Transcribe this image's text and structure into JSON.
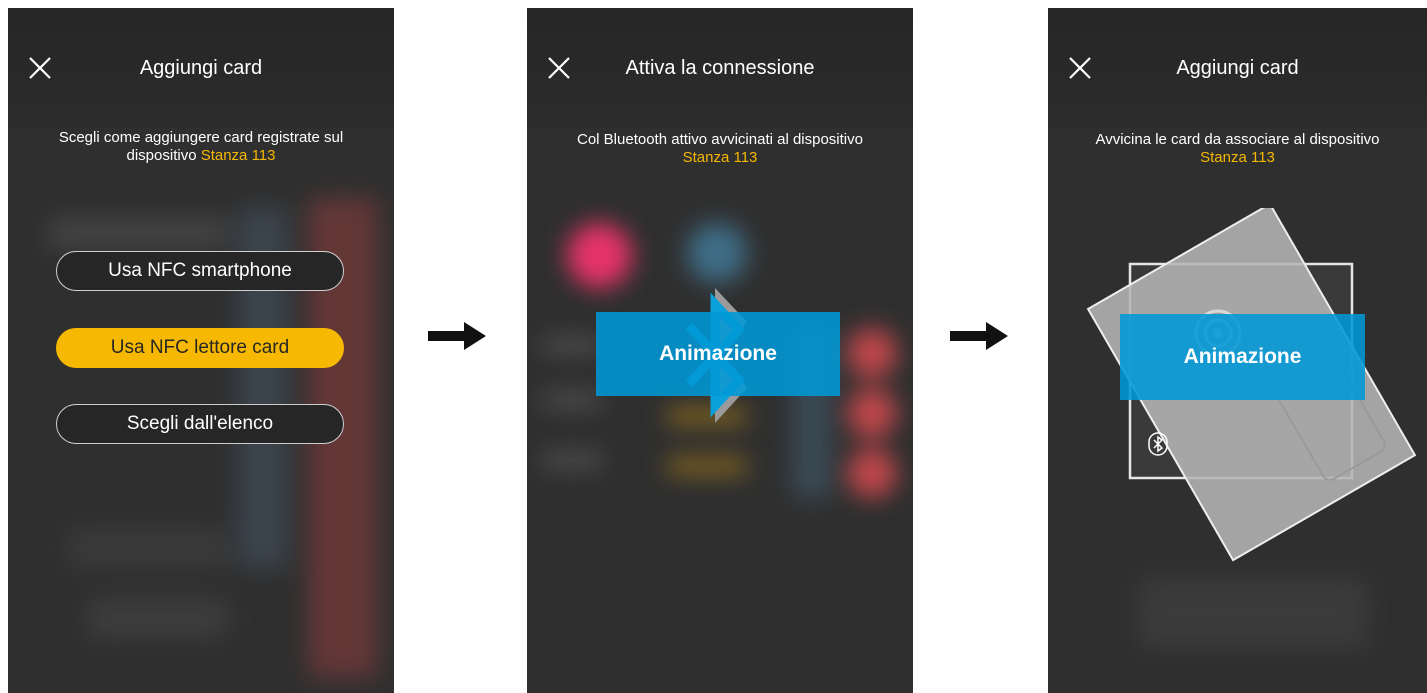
{
  "screens": [
    {
      "title": "Aggiungi card",
      "instruction_line1": "Scegli come aggiungere card registrate sul",
      "instruction_line2_prefix": "dispositivo ",
      "device_name": "Stanza 113",
      "buttons": [
        {
          "label": "Usa NFC smartphone",
          "selected": false
        },
        {
          "label": "Usa NFC lettore card",
          "selected": true
        },
        {
          "label": "Scegli dall'elenco",
          "selected": false
        }
      ]
    },
    {
      "title": "Attiva la connessione",
      "instruction_line1": "Col Bluetooth attivo avvicinati al dispositivo",
      "device_name": "Stanza 113",
      "animation_label": "Animazione"
    },
    {
      "title": "Aggiungi card",
      "instruction_line1": "Avvicina le card da associare al dispositivo",
      "device_name": "Stanza 113",
      "animation_label": "Animazione"
    }
  ],
  "colors": {
    "accent": "#f6b800",
    "animation_box": "#0099d6",
    "screen_bg": "#2f2f2f"
  },
  "icons": [
    "close-icon",
    "bluetooth-icon",
    "nfc-icon",
    "arrow-right-icon"
  ]
}
